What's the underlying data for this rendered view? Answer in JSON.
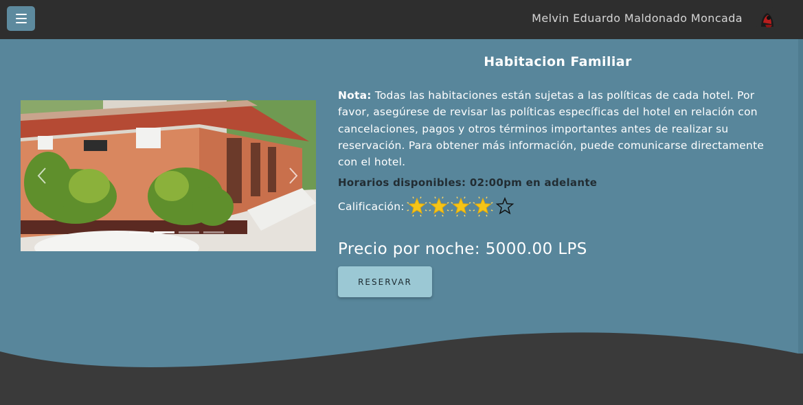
{
  "header": {
    "user_name": "Melvin Eduardo Maldonado Moncada",
    "menu_icon": "hamburger-icon"
  },
  "room": {
    "title": "Habitacion Familiar",
    "note_label": "Nota:",
    "note_text": "Todas las habitaciones están sujetas a las políticas de cada hotel. Por favor, asegúrese de revisar las políticas específicas del hotel en relación con cancelaciones, pagos y otros términos importantes antes de realizar su reservación. Para obtener más información, puede comunicarse directamente con el hotel.",
    "schedule": "Horarios disponibles: 02:00pm en adelante",
    "rating_label": "Calificación:",
    "rating": 4,
    "rating_max": 5,
    "price": "Precio por noche: 5000.00 LPS",
    "reserve_label": "RESERVAR"
  },
  "carousel": {
    "prev_icon": "chevron-left-icon",
    "next_icon": "chevron-right-icon",
    "slides": 4,
    "active_slide": 1
  },
  "colors": {
    "topbar": "#2e2e2e",
    "main": "#58869b",
    "button": "#9bc8d4",
    "star": "#f5c518"
  }
}
